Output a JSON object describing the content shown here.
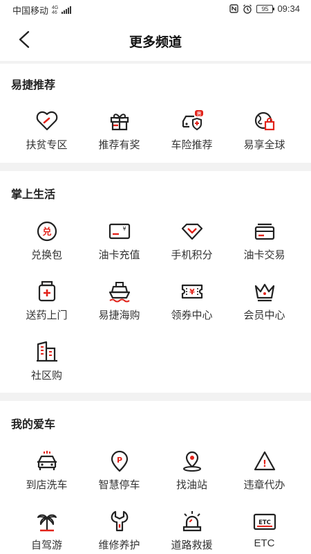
{
  "status_bar": {
    "carrier": "中国移动",
    "network_top": "4G",
    "network_bottom": "46",
    "battery": "95",
    "time": "09:34"
  },
  "header": {
    "title": "更多频道"
  },
  "sections": [
    {
      "title": "易捷推荐",
      "items": [
        {
          "label": "扶贫专区",
          "icon": "heart-hand-icon"
        },
        {
          "label": "推荐有奖",
          "icon": "gift-icon"
        },
        {
          "label": "车险推荐",
          "icon": "car-shield-icon",
          "badge": "惠"
        },
        {
          "label": "易享全球",
          "icon": "globe-bag-icon"
        }
      ]
    },
    {
      "title": "掌上生活",
      "items": [
        {
          "label": "兑换包",
          "icon": "exchange-icon",
          "glyph": "兑"
        },
        {
          "label": "油卡充值",
          "icon": "card-yen-icon",
          "glyph": "¥"
        },
        {
          "label": "手机积分",
          "icon": "diamond-icon"
        },
        {
          "label": "油卡交易",
          "icon": "card-stack-icon"
        },
        {
          "label": "送药上门",
          "icon": "medicine-icon"
        },
        {
          "label": "易捷海购",
          "icon": "ship-icon"
        },
        {
          "label": "领券中心",
          "icon": "coupon-icon",
          "glyph": "¥"
        },
        {
          "label": "会员中心",
          "icon": "crown-icon"
        },
        {
          "label": "社区购",
          "icon": "building-icon"
        }
      ]
    },
    {
      "title": "我的爱车",
      "items": [
        {
          "label": "到店洗车",
          "icon": "car-wash-icon"
        },
        {
          "label": "智慧停车",
          "icon": "parking-pin-icon",
          "glyph": "P"
        },
        {
          "label": "找油站",
          "icon": "location-pin-icon"
        },
        {
          "label": "违章代办",
          "icon": "warning-icon",
          "glyph": "!"
        },
        {
          "label": "自驾游",
          "icon": "palm-tree-icon"
        },
        {
          "label": "维修养护",
          "icon": "wrench-icon"
        },
        {
          "label": "道路救援",
          "icon": "siren-icon"
        },
        {
          "label": "ETC",
          "icon": "etc-card-icon",
          "glyph": "ETC"
        }
      ]
    }
  ],
  "colors": {
    "accent": "#e2231a",
    "icon": "#222222",
    "divider": "#f2f2f2"
  }
}
